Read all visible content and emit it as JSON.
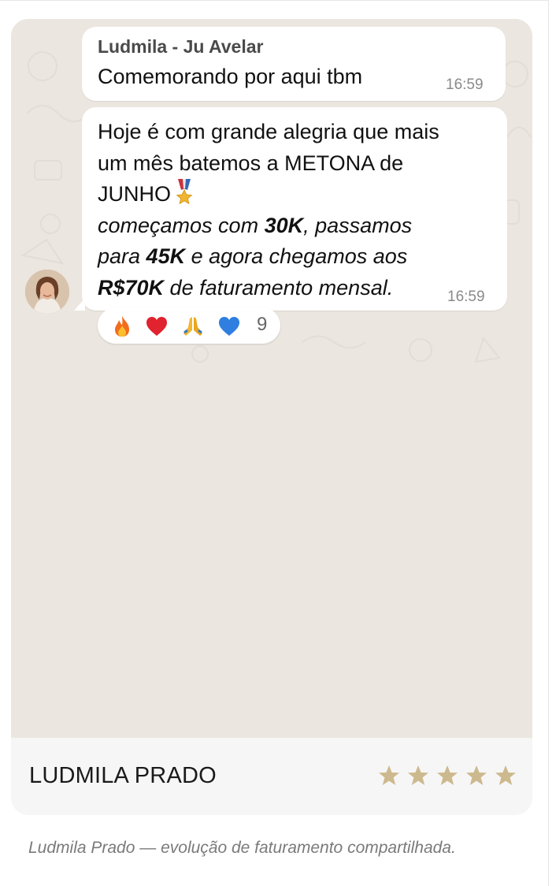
{
  "chat": {
    "message1": {
      "sender": "Ludmila - Ju Avelar",
      "text": "Comemorando por aqui tbm",
      "time": "16:59"
    },
    "message2": {
      "line1": "Hoje é com grande alegria que mais",
      "line2": "um mês batemos a METONA de",
      "line3": "JUNHO",
      "line4_part1": "começamos com ",
      "line4_bold": "30K",
      "line4_part2": ", passamos",
      "line5_part1": "para ",
      "line5_bold": "45K",
      "line5_part2": " e agora chegamos aos",
      "line6_bold": "R$70K",
      "line6_part2": " de faturamento mensal.",
      "time": "16:59",
      "emoji_icon": "medal-icon"
    },
    "reactions": {
      "icons": [
        "fire-icon",
        "red-heart-icon",
        "praying-hands-icon",
        "blue-heart-icon"
      ],
      "count": "9"
    }
  },
  "testimonial": {
    "author": "LUDMILA PRADO",
    "rating": 5,
    "rating_max": 5
  },
  "caption": "Ludmila Prado — evolução de faturamento compartilhada.",
  "colors": {
    "chat_background": "#ebe6df",
    "bubble": "#ffffff",
    "star": "#cdb98e",
    "card": "#f6f6f6"
  }
}
